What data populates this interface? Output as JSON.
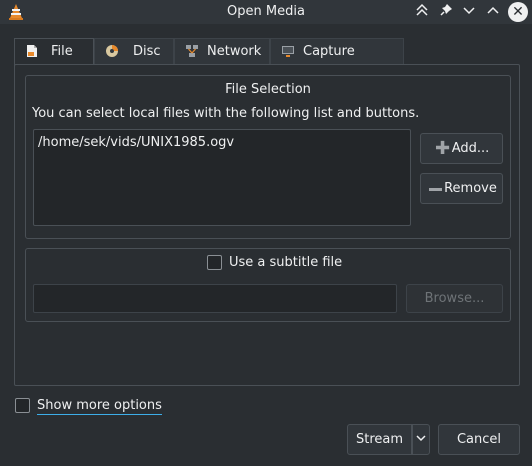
{
  "window": {
    "title": "Open Media",
    "controls": [
      "keep-above-icon",
      "pin-icon",
      "minimize-icon",
      "maximize-icon",
      "close-icon"
    ]
  },
  "tabs": [
    {
      "label": "File",
      "icon": "file-icon",
      "active": true
    },
    {
      "label": "Disc",
      "icon": "disc-icon",
      "active": false
    },
    {
      "label": "Network",
      "icon": "network-icon",
      "active": false
    },
    {
      "label": "Capture Device",
      "icon": "capture-device-icon",
      "active": false
    }
  ],
  "file_selection": {
    "title": "File Selection",
    "hint": "You can select local files with the following list and buttons.",
    "files": [
      "/home/sek/vids/UNIX1985.ogv"
    ],
    "add_label": "Add...",
    "remove_label": "Remove"
  },
  "subtitle": {
    "checkbox_label": "Use a subtitle file",
    "checked": false,
    "path_value": "",
    "browse_label": "Browse..."
  },
  "footer": {
    "show_more_label": "Show more options",
    "show_more_checked": false,
    "stream_label": "Stream",
    "cancel_label": "Cancel"
  },
  "colors": {
    "background": "#2a2e32",
    "accent": "#3daee9",
    "text": "#eff0f1"
  }
}
